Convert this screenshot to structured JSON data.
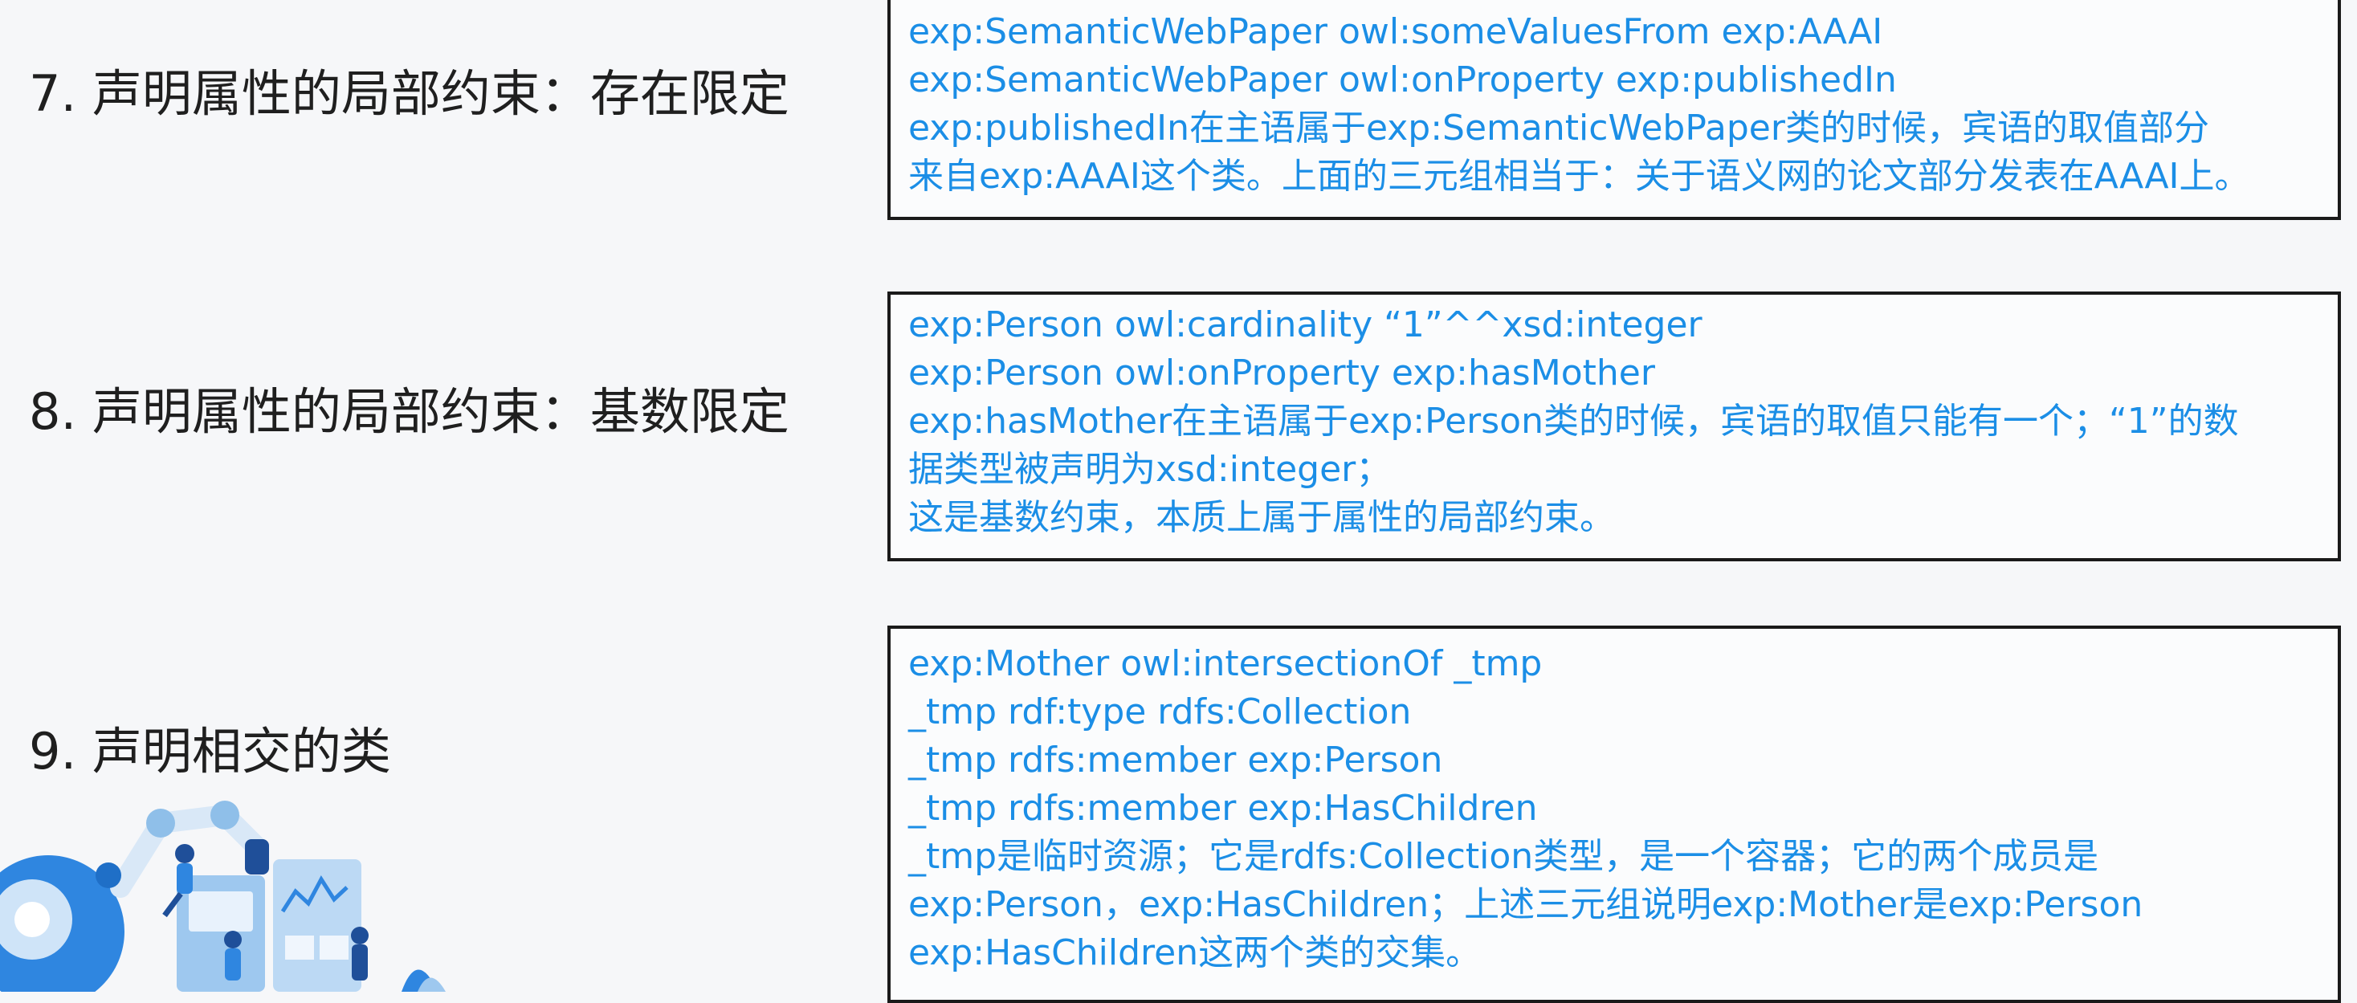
{
  "sections": [
    {
      "label": "7. 声明属性的局部约束：存在限定",
      "lines": [
        "exp:SemanticWebPaper owl:someValuesFrom exp:AAAI",
        "exp:SemanticWebPaper owl:onProperty exp:publishedIn",
        "exp:publishedIn在主语属于exp:SemanticWebPaper类的时候，宾语的取值部分",
        "来自exp:AAAI这个类。上面的三元组相当于：关于语义网的论文部分发表在AAAI上。"
      ]
    },
    {
      "label": "8. 声明属性的局部约束：基数限定",
      "lines": [
        "exp:Person owl:cardinality “1”^^xsd:integer",
        "exp:Person owl:onProperty exp:hasMother",
        "exp:hasMother在主语属于exp:Person类的时候，宾语的取值只能有一个；“1”的数",
        "据类型被声明为xsd:integer；",
        "这是基数约束，本质上属于属性的局部约束。"
      ]
    },
    {
      "label": "9. 声明相交的类",
      "lines": [
        "exp:Mother owl:intersectionOf _tmp",
        "_tmp rdf:type rdfs:Collection",
        "_tmp rdfs:member exp:Person",
        "_tmp rdfs:member exp:HasChildren",
        "_tmp是临时资源；它是rdfs:Collection类型，是一个容器；它的两个成员是",
        "exp:Person，exp:HasChildren；上述三元组说明exp:Mother是exp:Person",
        " exp:HasChildren这两个类的交集。"
      ]
    }
  ]
}
